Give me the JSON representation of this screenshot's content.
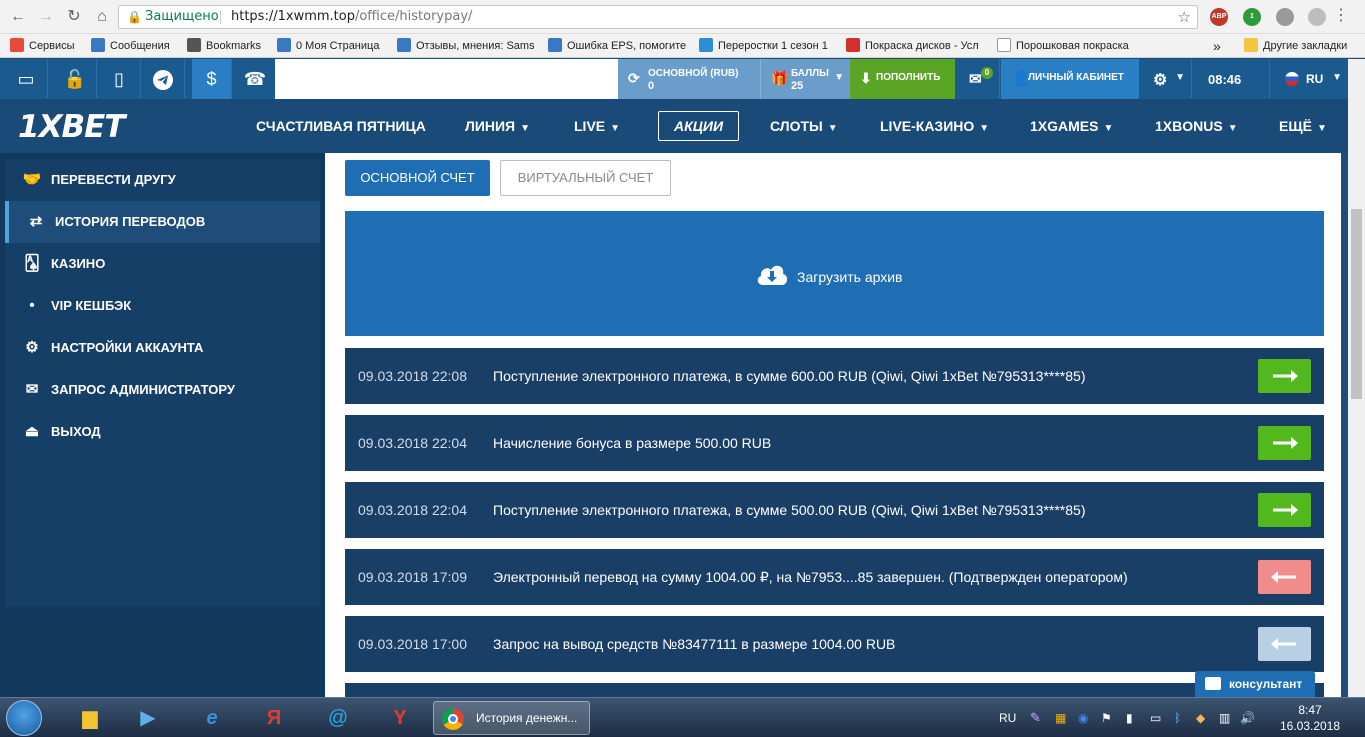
{
  "browser": {
    "secure_label": "Защищено",
    "url_host": "https://1xwmm.top",
    "url_path": "/office/historypay/",
    "extensions": [
      {
        "name": "adblock-icon",
        "label": "ABP",
        "color": "#c0392b"
      },
      {
        "name": "shield-extension-icon",
        "label": "1",
        "color": "#2e9b3a"
      },
      {
        "name": "gear-extension-icon",
        "label": "",
        "color": "#9a9a9a"
      },
      {
        "name": "smiley-extension-icon",
        "label": "",
        "color": "#bdbdbd"
      }
    ],
    "bookmarks": [
      {
        "label": "Сервисы",
        "icon": "apps-grid-icon",
        "color": "#e84a3a"
      },
      {
        "label": "Сообщения",
        "icon": "message-icon",
        "color": "#3b78c4"
      },
      {
        "label": "Bookmarks",
        "icon": "star-bookmark-icon",
        "color": "#555555"
      },
      {
        "label": "0 Моя Страница",
        "icon": "message-icon",
        "color": "#3b78c4"
      },
      {
        "label": "Отзывы, мнения: Sams",
        "icon": "link-icon",
        "color": "#3b78c4"
      },
      {
        "label": "Ошибка EPS, помогите",
        "icon": "link-icon",
        "color": "#3b78c4"
      },
      {
        "label": "Переростки 1 сезон 1",
        "icon": "pin-icon",
        "color": "#2a8fd6"
      },
      {
        "label": "Покраска дисков - Усл",
        "icon": "red-circle-icon",
        "color": "#d32f2f"
      },
      {
        "label": "Порошковая покраска",
        "icon": "page-icon",
        "color": "#ffffff"
      }
    ],
    "more_bookmarks": "»",
    "other_bookmarks": "Другие закладки"
  },
  "topbar": {
    "main_account_caption": "ОСНОВНОЙ (RUB)",
    "main_account_value": "0",
    "points_caption": "БАЛЛЫ",
    "points_value": "25",
    "deposit_label": "ПОПОЛНИТЬ",
    "messages_badge": "0",
    "cabinet_label": "ЛИЧНЫЙ КАБИНЕТ",
    "time": "08:46",
    "language": "RU"
  },
  "nav": {
    "logo": "1XBET",
    "items": [
      {
        "label": "СЧАСТЛИВАЯ ПЯТНИЦА",
        "dropdown": false
      },
      {
        "label": "ЛИНИЯ",
        "dropdown": true
      },
      {
        "label": "LIVE",
        "dropdown": true
      },
      {
        "label": "АКЦИИ",
        "dropdown": false
      },
      {
        "label": "СЛОТЫ",
        "dropdown": true
      },
      {
        "label": "LIVE-КАЗИНО",
        "dropdown": true
      },
      {
        "label": "1XGAMES",
        "dropdown": true
      },
      {
        "label": "1XBONUS",
        "dropdown": true
      },
      {
        "label": "ЕЩЁ",
        "dropdown": true
      }
    ]
  },
  "sidebar": {
    "items": [
      {
        "label": "ПЕРЕВЕСТИ ДРУГУ",
        "icon": "transfer-hands-icon"
      },
      {
        "label": "ИСТОРИЯ ПЕРЕВОДОВ",
        "icon": "arrows-exchange-icon"
      },
      {
        "label": "КАЗИНО",
        "icon": "cards-icon"
      },
      {
        "label": "VIP КЕШБЭК",
        "icon": "bullet-icon"
      },
      {
        "label": "НАСТРОЙКИ АККАУНТА",
        "icon": "gears-icon"
      },
      {
        "label": "ЗАПРОС АДМИНИСТРАТОРУ",
        "icon": "envelope-icon"
      },
      {
        "label": "ВЫХОД",
        "icon": "exit-icon"
      }
    ]
  },
  "content": {
    "tab_main": "ОСНОВНОЙ СЧЕТ",
    "tab_virtual": "ВИРТУАЛЬНЫЙ СЧЕТ",
    "archive_label": "Загрузить архив",
    "history": [
      {
        "date": "09.03.2018 22:08",
        "text": "Поступление электронного платежа, в сумме 600.00 RUB (Qiwi, Qiwi 1xBet №795313****85)",
        "direction": "in",
        "color": "#53b81d"
      },
      {
        "date": "09.03.2018 22:04",
        "text": "Начисление бонуса в размере 500.00 RUB",
        "direction": "in",
        "color": "#53b81d"
      },
      {
        "date": "09.03.2018 22:04",
        "text": "Поступление электронного платежа, в сумме 500.00 RUB (Qiwi, Qiwi 1xBet №795313****85)",
        "direction": "in",
        "color": "#53b81d"
      },
      {
        "date": "09.03.2018 17:09",
        "text": "Электронный перевод на сумму 1004.00 ₽, на №7953....85 завершен. (Подтвержден оператором)",
        "direction": "out",
        "color": "#f08c8c"
      },
      {
        "date": "09.03.2018 17:00",
        "text": "Запрос на вывод средств №83477111 в размере 1004.00 RUB",
        "direction": "out",
        "color": "#b9cfe3"
      }
    ]
  },
  "consultant_label": "консультант",
  "taskbar": {
    "active_task": "История денежн...",
    "lang": "RU",
    "time": "8:47",
    "date": "16.03.2018"
  }
}
